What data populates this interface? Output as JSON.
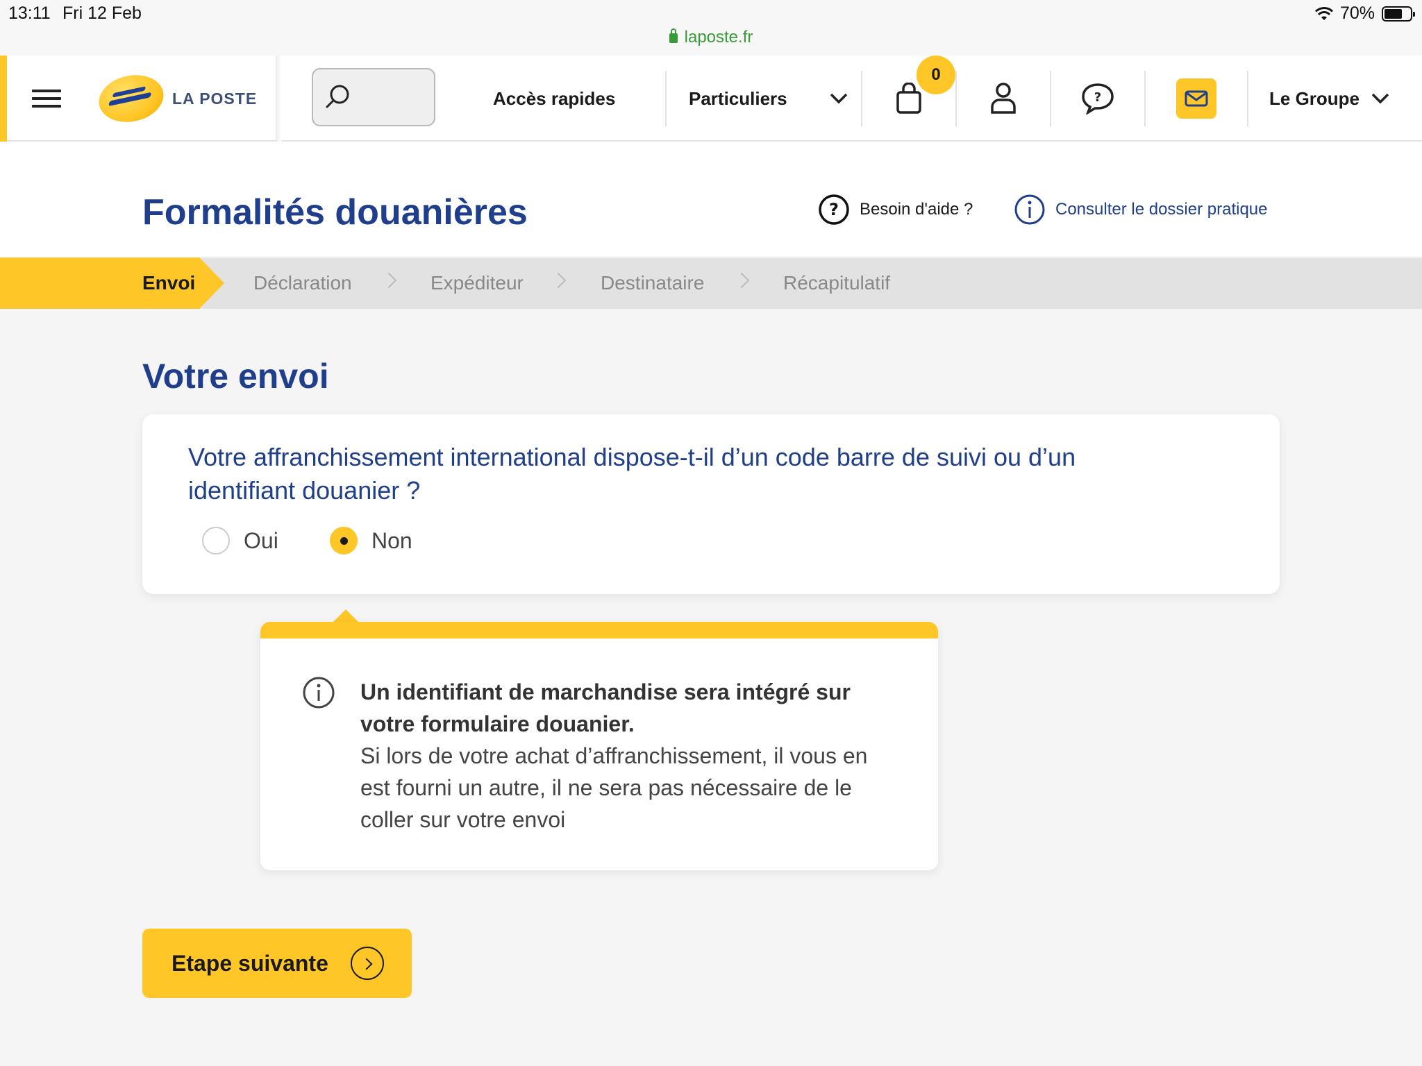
{
  "status_bar": {
    "time": "13:11",
    "date": "Fri 12 Feb",
    "url": "laposte.fr",
    "battery": "70%",
    "battery_level": 0.7
  },
  "navbar": {
    "logo_text": "LA POSTE",
    "search_placeholder": "",
    "quick_access": "Accès rapides",
    "audience": "Particuliers",
    "cart_count": "0",
    "group": "Le Groupe"
  },
  "header": {
    "title": "Formalités douanières",
    "help": "Besoin d'aide ?",
    "doc": "Consulter le dossier pratique"
  },
  "stepper": {
    "steps": [
      "Envoi",
      "Déclaration",
      "Expéditeur",
      "Destinataire",
      "Récapitulatif"
    ],
    "active_index": 0
  },
  "section": {
    "title": "Votre envoi"
  },
  "question": {
    "text": "Votre affranchissement international dispose-t-il d’un code barre de suivi ou d’un identifiant douanier ?",
    "options": [
      "Oui",
      "Non"
    ],
    "selected": "Non"
  },
  "info": {
    "bold": "Un identifiant de marchandise sera intégré sur votre formulaire douanier.",
    "text": "Si lors de votre achat d’affranchissement, il vous en est fourni un autre, il ne sera pas nécessaire de le coller sur votre envoi"
  },
  "next_button": "Etape suivante",
  "colors": {
    "brand_yellow": "#ffc627",
    "brand_blue": "#1f3e8b"
  }
}
